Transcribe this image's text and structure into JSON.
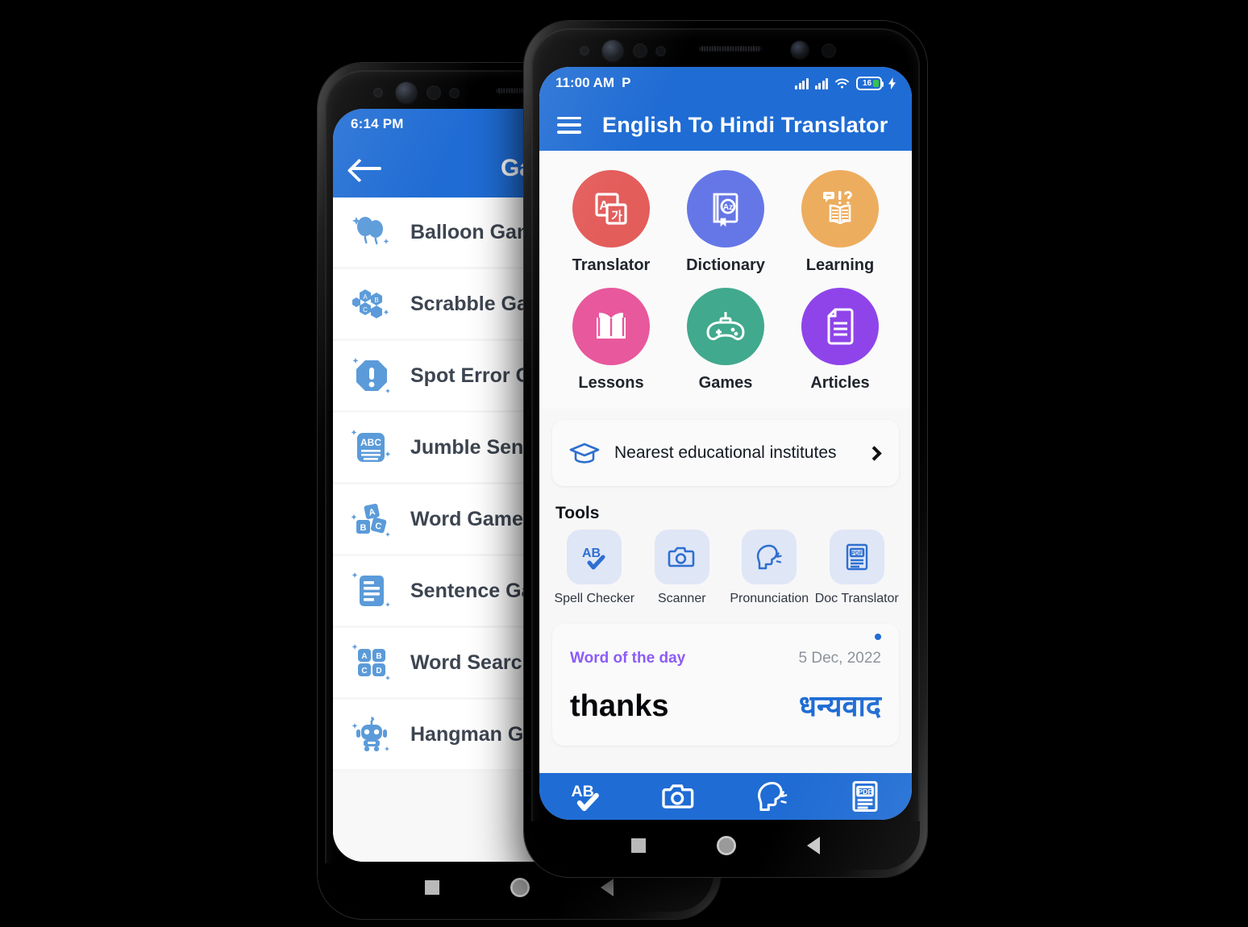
{
  "scene": {
    "background_color": "#000000",
    "brand_blue": "#1f6cd4"
  },
  "back_phone": {
    "status_bar": {
      "time": "6:14 PM"
    },
    "app_bar": {
      "title": "Games",
      "back_icon": "arrow-left-icon"
    },
    "games": [
      {
        "label": "Balloon Game",
        "icon": "balloon-icon"
      },
      {
        "label": "Scrabble Game",
        "icon": "scrabble-hexagon-letters-icon"
      },
      {
        "label": "Spot Error Game",
        "icon": "octagon-exclamation-icon"
      },
      {
        "label": "Jumble Sentence",
        "icon": "abc-card-icon"
      },
      {
        "label": "Word Game",
        "icon": "letter-blocks-icon"
      },
      {
        "label": "Sentence Game",
        "icon": "document-lines-icon"
      },
      {
        "label": "Word Search Game",
        "icon": "abcd-grid-icon"
      },
      {
        "label": "Hangman Game",
        "icon": "robot-icon"
      }
    ]
  },
  "front_phone": {
    "status_bar": {
      "time": "11:00 AM",
      "parking_icon": "P",
      "signal_icon_1": "signal-bars-icon",
      "signal_icon_2": "signal-bars-icon",
      "wifi_icon": "wifi-icon",
      "battery_level": "16",
      "charging_icon": "lightning-bolt-icon"
    },
    "app_bar": {
      "menu_icon": "hamburger-menu-icon",
      "title": "English To Hindi Translator"
    },
    "features": [
      {
        "label": "Translator",
        "color": "#e35d5b",
        "icon": "translate-icon"
      },
      {
        "label": "Dictionary",
        "color": "#6577e6",
        "icon": "dictionary-book-icon"
      },
      {
        "label": "Learning",
        "color": "#edad5f",
        "icon": "open-book-question-icon"
      },
      {
        "label": "Lessons",
        "color": "#e8589c",
        "icon": "open-book-icon"
      },
      {
        "label": "Games",
        "color": "#41a98d",
        "icon": "gamepad-icon"
      },
      {
        "label": "Articles",
        "color": "#8f44ea",
        "icon": "article-document-icon"
      }
    ],
    "nearest_institutes": {
      "label": "Nearest educational institutes",
      "icon": "graduation-cap-icon",
      "chevron": "chevron-right-icon"
    },
    "tools_section": {
      "heading": "Tools",
      "tools": [
        {
          "label": "Spell Checker",
          "icon": "ab-check-icon"
        },
        {
          "label": "Scanner",
          "icon": "camera-icon"
        },
        {
          "label": "Pronunciation",
          "icon": "speaking-head-icon"
        },
        {
          "label": "Doc Translator",
          "icon": "pdf-document-icon"
        }
      ]
    },
    "word_of_the_day": {
      "label": "Word of the day",
      "label_color": "#8b5cf6",
      "date": "5 Dec, 2022",
      "english": "thanks",
      "hindi": "धन्यवाद",
      "hindi_color": "#1f6cd4",
      "has_notification_dot": true
    },
    "bottom_nav": [
      {
        "icon": "ab-check-icon"
      },
      {
        "icon": "camera-icon"
      },
      {
        "icon": "speaking-head-icon"
      },
      {
        "icon": "pdf-document-icon"
      }
    ],
    "android_nav": {
      "recents_icon": "square-icon",
      "home_icon": "circle-icon",
      "back_icon": "triangle-back-icon"
    }
  }
}
